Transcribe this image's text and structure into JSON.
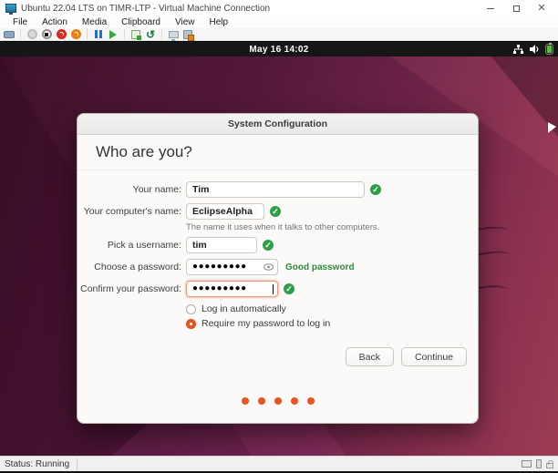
{
  "window": {
    "title": "Ubuntu 22.04 LTS on TIMR-LTP - Virtual Machine Connection",
    "menu": [
      "File",
      "Action",
      "Media",
      "Clipboard",
      "View",
      "Help"
    ],
    "toolbar_icons": [
      "ctrl-alt-del",
      "start",
      "turn-off",
      "shut-down",
      "save",
      "pause",
      "resume",
      "checkpoint",
      "revert",
      "enhanced-session",
      "settings"
    ],
    "status": "Status: Running",
    "status_icons": [
      "display-icon",
      "usb-icon",
      "lock-icon"
    ]
  },
  "vm": {
    "topbar": {
      "clock": "May 16  14:02",
      "tray_icons": [
        "network-icon",
        "volume-icon",
        "battery-icon"
      ]
    }
  },
  "dialog": {
    "title": "System Configuration",
    "heading": "Who are you?",
    "fields": {
      "name": {
        "label": "Your name:",
        "value": "Tim",
        "status": "valid"
      },
      "computer": {
        "label": "Your computer's name:",
        "value": "EclipseAlpha",
        "status": "valid",
        "hint": "The name it uses when it talks to other computers."
      },
      "username": {
        "label": "Pick a username:",
        "value": "tim",
        "status": "valid"
      },
      "password": {
        "label": "Choose a password:",
        "value": "●●●●●●●●●",
        "status_text": "Good password"
      },
      "confirm": {
        "label": "Confirm your password:",
        "value": "●●●●●●●●●",
        "status": "valid",
        "focused": true
      }
    },
    "radios": [
      {
        "label": "Log in automatically",
        "selected": false
      },
      {
        "label": "Require my password to log in",
        "selected": true
      }
    ],
    "buttons": {
      "back": "Back",
      "continue": "Continue"
    },
    "page_dot_count": 5
  },
  "colors": {
    "accent_orange": "#E95420",
    "valid_green": "#2E9E49",
    "good_password_text": "#2E8B3A",
    "desktop_purple": "#5B1C3F"
  }
}
